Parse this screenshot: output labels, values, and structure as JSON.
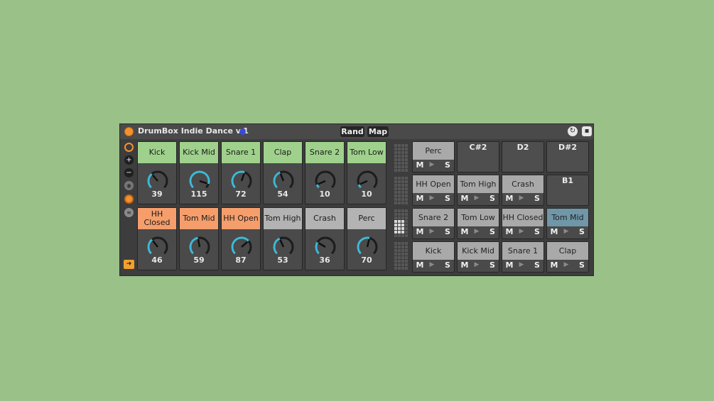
{
  "device": {
    "title": "DrumBox Indie Dance v.1",
    "rand_label": "Rand",
    "map_label": "Map",
    "hotswap_icon": "refresh-icon",
    "save_icon": "save-icon"
  },
  "sidebar": {
    "icons": [
      "target-icon",
      "plus-icon",
      "minus-icon",
      "camera-icon",
      "toggle-icon",
      "list-icon",
      "arrow-right-icon"
    ]
  },
  "pads": [
    {
      "label": "Kick",
      "value": "39",
      "fraction": 0.35,
      "color": "#9fd18c"
    },
    {
      "label": "Kick Mid",
      "value": "115",
      "fraction": 0.9,
      "color": "#9fd18c"
    },
    {
      "label": "Snare 1",
      "value": "72",
      "fraction": 0.57,
      "color": "#9fd18c"
    },
    {
      "label": "Clap",
      "value": "54",
      "fraction": 0.42,
      "color": "#9fd18c"
    },
    {
      "label": "Snare 2",
      "value": "10",
      "fraction": 0.08,
      "color": "#9fd18c"
    },
    {
      "label": "Tom Low",
      "value": "10",
      "fraction": 0.08,
      "color": "#9fd18c"
    },
    {
      "label": "HH Closed",
      "value": "46",
      "fraction": 0.36,
      "color": "#f59e6c"
    },
    {
      "label": "Tom Mid",
      "value": "59",
      "fraction": 0.46,
      "color": "#f59e6c"
    },
    {
      "label": "HH Open",
      "value": "87",
      "fraction": 0.68,
      "color": "#f59e6c"
    },
    {
      "label": "Tom High",
      "value": "53",
      "fraction": 0.41,
      "color": "#b3b3b3"
    },
    {
      "label": "Crash",
      "value": "36",
      "fraction": 0.28,
      "color": "#b3b3b3"
    },
    {
      "label": "Perc",
      "value": "70",
      "fraction": 0.55,
      "color": "#b3b3b3"
    }
  ],
  "chains": {
    "mute_label": "M",
    "solo_label": "S",
    "play_glyph": "▶",
    "rows": [
      [
        {
          "label": "Perc",
          "empty": false,
          "color": "#a9a9a9"
        },
        {
          "label": "C#2",
          "empty": true
        },
        {
          "label": "D2",
          "empty": true
        },
        {
          "label": "D#2",
          "empty": true
        }
      ],
      [
        {
          "label": "HH Open",
          "empty": false,
          "color": "#a9a9a9"
        },
        {
          "label": "Tom High",
          "empty": false,
          "color": "#a9a9a9"
        },
        {
          "label": "Crash",
          "empty": false,
          "color": "#a9a9a9"
        },
        {
          "label": "B1",
          "empty": true
        }
      ],
      [
        {
          "label": "Snare 2",
          "empty": false,
          "color": "#a9a9a9"
        },
        {
          "label": "Tom Low",
          "empty": false,
          "color": "#a9a9a9"
        },
        {
          "label": "HH Closed",
          "empty": false,
          "color": "#a9a9a9"
        },
        {
          "label": "Tom Mid",
          "empty": false,
          "color": "#6f97a8"
        }
      ],
      [
        {
          "label": "Kick",
          "empty": false,
          "color": "#a9a9a9"
        },
        {
          "label": "Kick Mid",
          "empty": false,
          "color": "#a9a9a9"
        },
        {
          "label": "Snare 1",
          "empty": false,
          "color": "#a9a9a9"
        },
        {
          "label": "Clap",
          "empty": false,
          "color": "#a9a9a9"
        }
      ]
    ]
  }
}
